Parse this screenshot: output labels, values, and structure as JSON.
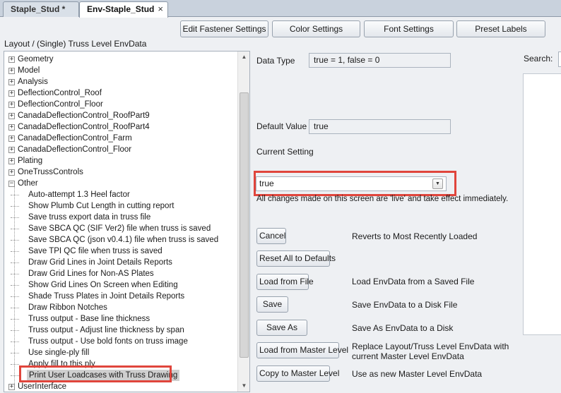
{
  "tabs": [
    {
      "label": "Staple_Stud *"
    },
    {
      "label": "Env-Staple_Stud",
      "close": "×"
    }
  ],
  "toolbar": {
    "edit_fastener": "Edit Fastener Settings",
    "color_settings": "Color Settings",
    "font_settings": "Font Settings",
    "preset_labels": "Preset Labels"
  },
  "breadcrumb": "Layout / (Single) Truss Level EnvData",
  "tree": {
    "top_items": [
      {
        "label": "Geometry",
        "expander": "+"
      },
      {
        "label": "Model",
        "expander": "+"
      },
      {
        "label": "Analysis",
        "expander": "+"
      },
      {
        "label": "DeflectionControl_Roof",
        "expander": "+"
      },
      {
        "label": "DeflectionControl_Floor",
        "expander": "+"
      },
      {
        "label": "CanadaDeflectionControl_RoofPart9",
        "expander": "+"
      },
      {
        "label": "CanadaDeflectionControl_RoofPart4",
        "expander": "+"
      },
      {
        "label": "CanadaDeflectionControl_Farm",
        "expander": "+"
      },
      {
        "label": "CanadaDeflectionControl_Floor",
        "expander": "+"
      },
      {
        "label": "Plating",
        "expander": "+"
      },
      {
        "label": "OneTrussControls",
        "expander": "+"
      },
      {
        "label": "Other",
        "expander": "−"
      }
    ],
    "other_children": [
      "Auto-attempt 1.3 Heel factor",
      "Show Plumb Cut Length in cutting report",
      "Save truss export data in truss file",
      "Save SBCA QC (SIF Ver2) file when truss is saved",
      "Save SBCA QC (json v0.4.1) file when truss is saved",
      "Save TPI QC file when truss is saved",
      "Draw Grid Lines in Joint Details Reports",
      "Draw Grid Lines for Non-AS Plates",
      "Show Grid Lines On Screen when Editing",
      "Shade Truss Plates in Joint Details Reports",
      "Draw Ribbon Notches",
      "Truss output - Base line thickness",
      "Truss output - Adjust line thickness by span",
      "Truss output - Use bold fonts on truss image",
      "Use single-ply fill",
      "Apply fill to this ply",
      "Print User Loadcases with Truss Drawing"
    ],
    "last_item": {
      "label": "UserInterface",
      "expander": "+"
    }
  },
  "details": {
    "data_type_label": "Data Type",
    "data_type_value": "true = 1, false = 0",
    "default_value_label": "Default Value",
    "default_value": "true",
    "current_setting_label": "Current Setting",
    "current_setting_value": "true",
    "live_note": "All changes made on this screen are 'live' and take effect immediately."
  },
  "actions": [
    {
      "label": "Cancel",
      "desc": "Reverts to Most Recently Loaded"
    },
    {
      "label": "Reset All to Defaults",
      "desc": ""
    },
    {
      "label": "Load from File",
      "desc": "Load EnvData from a Saved File"
    },
    {
      "label": "Save",
      "desc": "Save EnvData to a Disk File"
    },
    {
      "label": "Save As",
      "desc": "Save As EnvData to a Disk"
    },
    {
      "label": "Load from Master Level",
      "desc_line1": "Replace Layout/Truss Level EnvData with",
      "desc_line2": "current Master Level EnvData"
    },
    {
      "label": "Copy to Master Level",
      "desc": "Use as new Master Level EnvData"
    }
  ],
  "search": {
    "label": "Search:"
  },
  "colors": {
    "highlight_border": "#e0453c",
    "selection": "#cfcfcf"
  }
}
